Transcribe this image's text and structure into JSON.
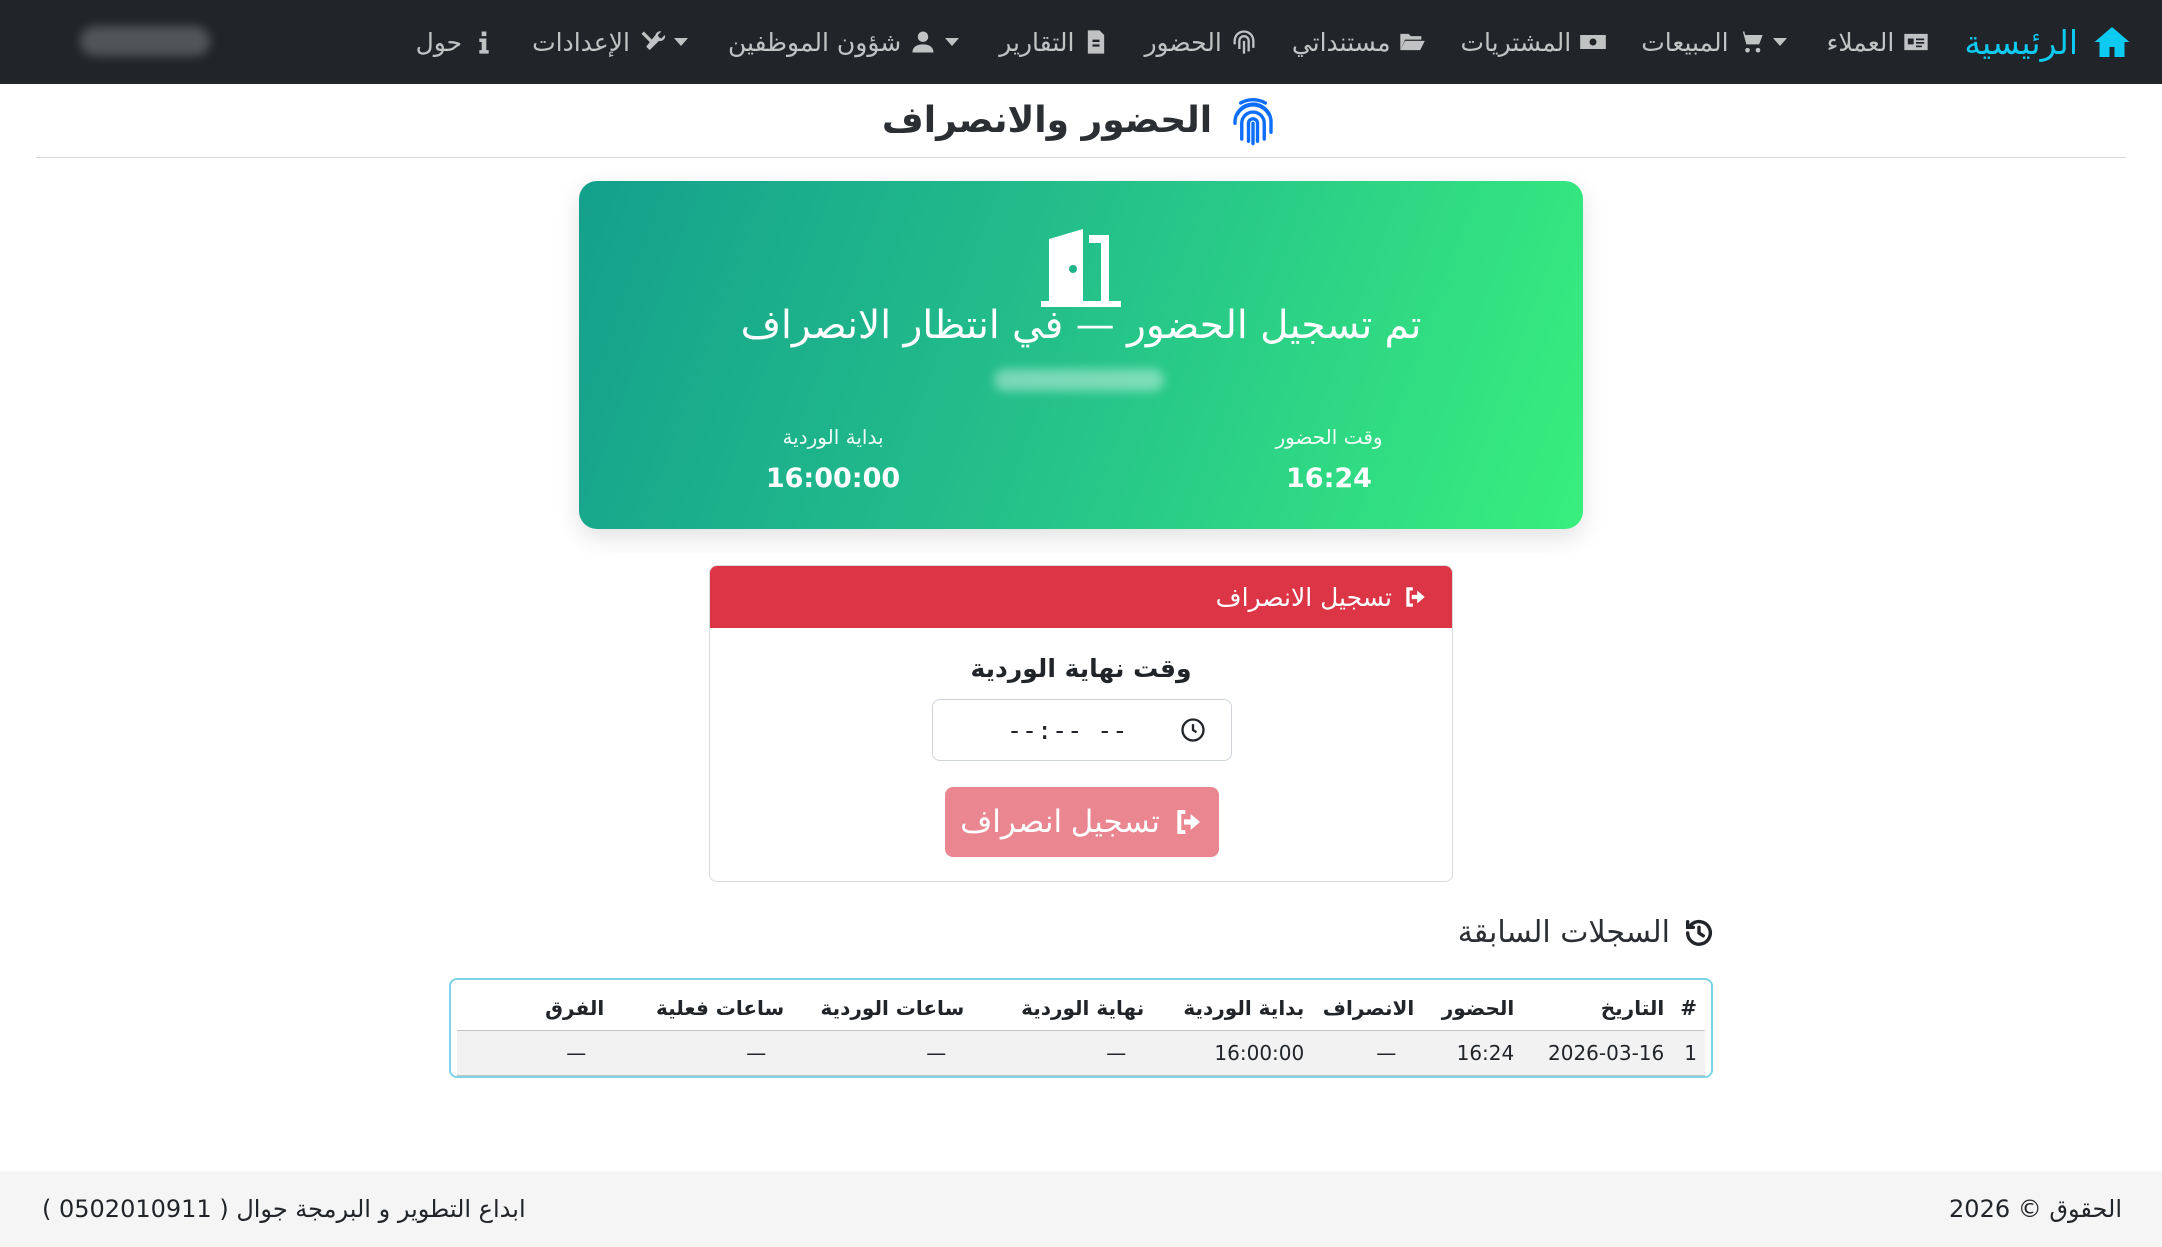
{
  "nav": {
    "brand": "الرئيسية",
    "items": [
      {
        "label": "العملاء",
        "icon": "id-card-icon"
      },
      {
        "label": "المبيعات",
        "icon": "cart-icon",
        "dropdown": true
      },
      {
        "label": "المشتريات",
        "icon": "money-icon"
      },
      {
        "label": "مستنداتي",
        "icon": "folder-icon"
      },
      {
        "label": "الحضور",
        "icon": "fingerprint-icon"
      },
      {
        "label": "التقارير",
        "icon": "report-icon"
      },
      {
        "label": "شؤون الموظفين",
        "icon": "user-icon",
        "dropdown": true
      },
      {
        "label": "الإعدادات",
        "icon": "tools-icon",
        "dropdown": true
      },
      {
        "label": "حول",
        "icon": "info-icon"
      }
    ]
  },
  "page": {
    "title": "الحضور والانصراف"
  },
  "status": {
    "heading": "تم تسجيل الحضور — في انتظار الانصراف",
    "checkin_label": "وقت الحضور",
    "checkin_value": "16:24",
    "shift_start_label": "بداية الوردية",
    "shift_start_value": "16:00:00"
  },
  "checkout": {
    "header": "تسجيل الانصراف",
    "shift_end_label": "وقت نهاية الوردية",
    "time_value": "--:-- --",
    "button": "تسجيل انصراف"
  },
  "history": {
    "title": "السجلات السابقة",
    "columns": [
      "#",
      "التاريخ",
      "الحضور",
      "الانصراف",
      "بداية الوردية",
      "نهاية الوردية",
      "ساعات الوردية",
      "ساعات فعلية",
      "الفرق"
    ],
    "rows": [
      [
        "1",
        "2026-03-16",
        "16:24",
        "—",
        "16:00:00",
        "—",
        "—",
        "—",
        "—"
      ]
    ]
  },
  "footer": {
    "copyright": "الحقوق © 2026",
    "credit": "ابداع التطوير و البرمجة جوال ( 0502010911 )"
  },
  "colors": {
    "navbar": "#212529",
    "brand": "#0dcaf0",
    "danger": "#dc3545",
    "gradient_start": "#14a08c",
    "gradient_end": "#38ef7d"
  }
}
